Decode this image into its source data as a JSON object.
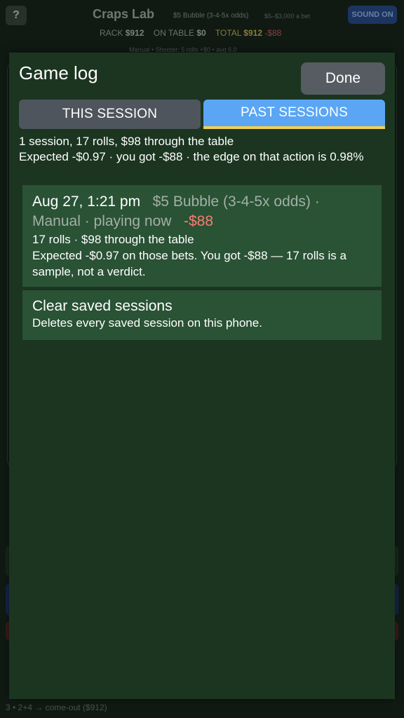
{
  "background": {
    "help_label": "?",
    "app_title": "Craps Lab",
    "table_name": "$5 Bubble (3-4-5x odds)",
    "table_limits": "$5–$3,000 a bet",
    "sound_label": "SOUND ON",
    "stats": {
      "rack_label": "RACK",
      "rack_value": "$912",
      "on_table_label": "ON TABLE",
      "on_table_value": "$0",
      "total_label": "TOTAL",
      "total_value": "$912",
      "total_delta": "-$88"
    },
    "meta": "Manual  •  Shooter: 5 rolls  +$0  •  avg 6.0",
    "log_tail": "3 • 2+4 → come-out ($912)"
  },
  "modal": {
    "title": "Game log",
    "done_label": "Done",
    "tabs": [
      {
        "label": "THIS SESSION",
        "selected": false
      },
      {
        "label": "PAST SESSIONS",
        "selected": true
      }
    ],
    "summary_line1": "1 session, 17 rolls, $98 through the table",
    "summary_line2": "Expected -$0.97 · you got -$88 · the edge on that action is 0.98%",
    "sessions": [
      {
        "date": "Aug 27, 1:21 pm",
        "table": "$5 Bubble (3-4-5x odds) ·",
        "mode_status": "Manual · playing now",
        "result": "-$88",
        "rolls_line": "17 rolls · $98 through the table",
        "expected_line": "Expected -$0.97 on those bets. You got -$88 — 17 rolls is a sample, not a verdict."
      }
    ],
    "clear": {
      "title": "Clear saved sessions",
      "subtitle": "Deletes every saved session on this phone."
    }
  },
  "colors": {
    "sheet_bg": "#1b3521",
    "card_bg": "#2a5235",
    "tab_selected": "#5aa6f5",
    "tab_underline": "#f3cf54",
    "tab_unselected": "#4e555c",
    "loss_red": "#ff7a70"
  }
}
